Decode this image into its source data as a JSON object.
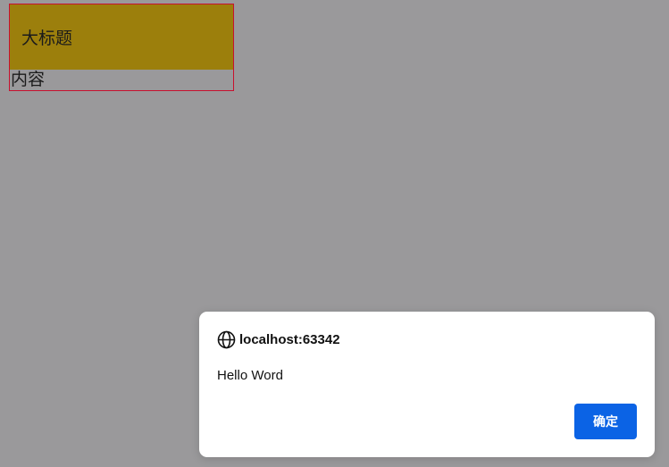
{
  "page": {
    "header_title": "大标题",
    "content_text": "内容"
  },
  "dialog": {
    "origin": "localhost:63342",
    "origin_icon": "globe-icon",
    "message": "Hello Word",
    "ok_label": "确定"
  },
  "colors": {
    "overlay": "#9a999b",
    "header_bg": "#9c7f0c",
    "box_border": "#c8102e",
    "button_bg": "#0b63e5"
  }
}
